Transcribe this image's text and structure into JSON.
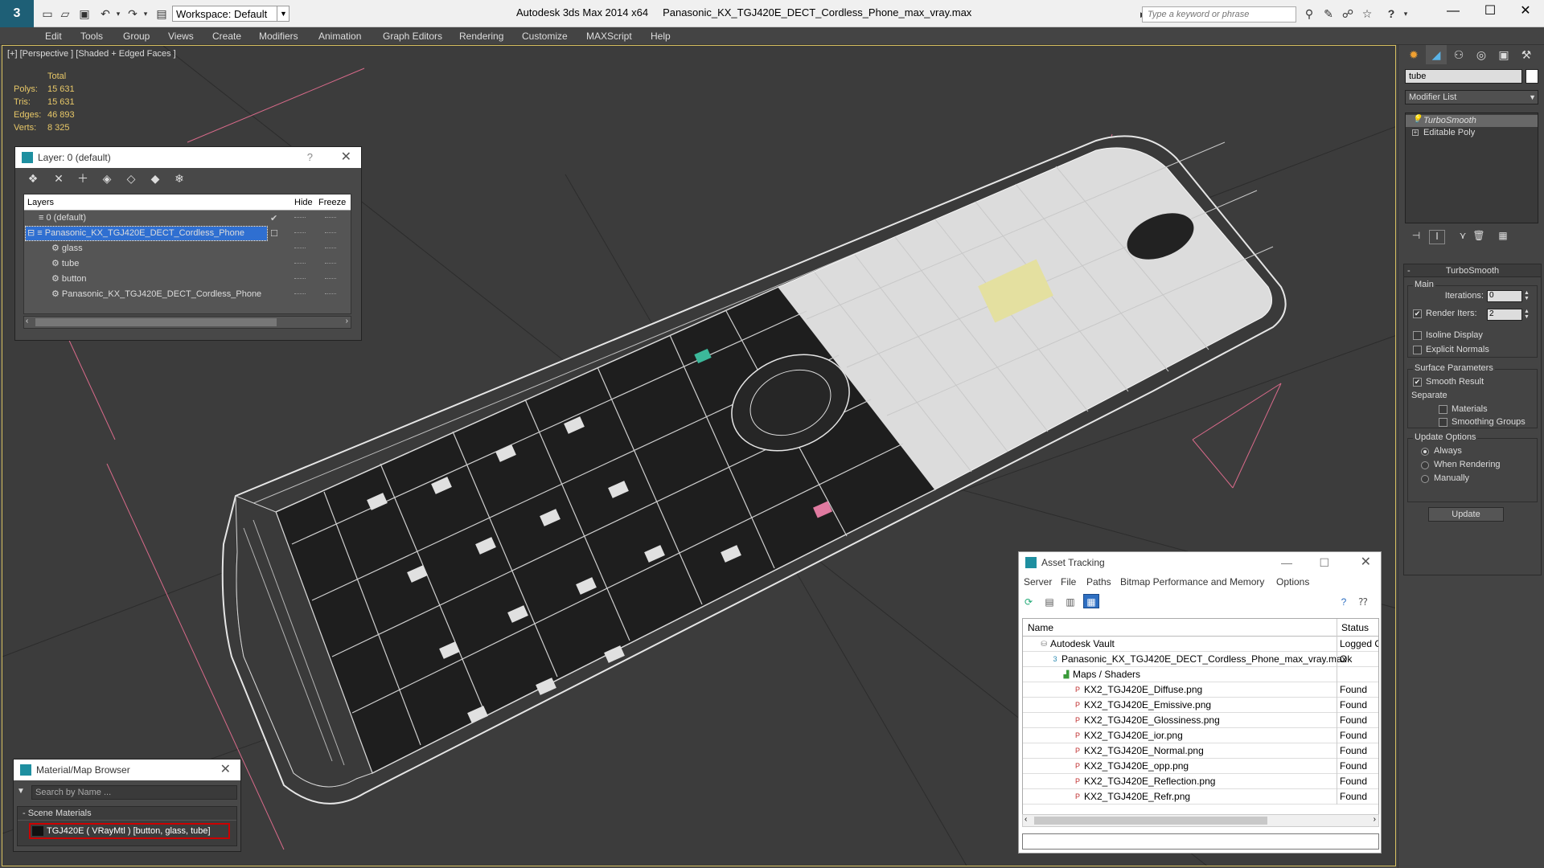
{
  "titlebar": {
    "workspace": "Workspace: Default",
    "app_name": "Autodesk 3ds Max  2014 x64",
    "file_name": "Panasonic_KX_TGJ420E_DECT_Cordless_Phone_max_vray.max",
    "search_placeholder": "Type a keyword or phrase",
    "help_icon": "?"
  },
  "menu": [
    "Edit",
    "Tools",
    "Group",
    "Views",
    "Create",
    "Modifiers",
    "Animation",
    "Graph Editors",
    "Rendering",
    "Customize",
    "MAXScript",
    "Help"
  ],
  "viewport": {
    "label": "[+] [Perspective ] [Shaded + Edged Faces ]",
    "stats": {
      "header": "Total",
      "rows": [
        {
          "label": "Polys:",
          "value": "15 631"
        },
        {
          "label": "Tris:",
          "value": "15 631"
        },
        {
          "label": "Edges:",
          "value": "46 893"
        },
        {
          "label": "Verts:",
          "value": "8 325"
        }
      ]
    }
  },
  "layer_dialog": {
    "title": "Layer: 0 (default)",
    "help": "?",
    "columns": {
      "layers": "Layers",
      "hide": "Hide",
      "freeze": "Freeze"
    },
    "rows": [
      {
        "name": "0 (default)",
        "indent": 0,
        "selected": false
      },
      {
        "name": "Panasonic_KX_TGJ420E_DECT_Cordless_Phone",
        "indent": 0,
        "selected": true
      },
      {
        "name": "glass",
        "indent": 1,
        "selected": false
      },
      {
        "name": "tube",
        "indent": 1,
        "selected": false
      },
      {
        "name": "button",
        "indent": 1,
        "selected": false
      },
      {
        "name": "Panasonic_KX_TGJ420E_DECT_Cordless_Phone",
        "indent": 1,
        "selected": false
      }
    ]
  },
  "material_browser": {
    "title": "Material/Map Browser",
    "search_placeholder": "Search by Name ...",
    "section": "- Scene Materials",
    "item": "TGJ420E  ( VRayMtl )  [button, glass, tube]"
  },
  "asset_tracking": {
    "title": "Asset Tracking",
    "menu": [
      "Server",
      "File",
      "Paths",
      "Bitmap Performance and Memory",
      "Options"
    ],
    "columns": {
      "name": "Name",
      "status": "Status"
    },
    "rows": [
      {
        "name": "Autodesk Vault",
        "status": "Logged O",
        "level": 0,
        "icon": "vault"
      },
      {
        "name": "Panasonic_KX_TGJ420E_DECT_Cordless_Phone_max_vray.max",
        "status": "Ok",
        "level": 1,
        "icon": "max"
      },
      {
        "name": "Maps / Shaders",
        "status": "",
        "level": 2,
        "icon": "maps"
      },
      {
        "name": "KX2_TGJ420E_Diffuse.png",
        "status": "Found",
        "level": 3,
        "icon": "png"
      },
      {
        "name": "KX2_TGJ420E_Emissive.png",
        "status": "Found",
        "level": 3,
        "icon": "png"
      },
      {
        "name": "KX2_TGJ420E_Glossiness.png",
        "status": "Found",
        "level": 3,
        "icon": "png"
      },
      {
        "name": "KX2_TGJ420E_ior.png",
        "status": "Found",
        "level": 3,
        "icon": "png"
      },
      {
        "name": "KX2_TGJ420E_Normal.png",
        "status": "Found",
        "level": 3,
        "icon": "png"
      },
      {
        "name": "KX2_TGJ420E_opp.png",
        "status": "Found",
        "level": 3,
        "icon": "png"
      },
      {
        "name": "KX2_TGJ420E_Reflection.png",
        "status": "Found",
        "level": 3,
        "icon": "png"
      },
      {
        "name": "KX2_TGJ420E_Refr.png",
        "status": "Found",
        "level": 3,
        "icon": "png"
      }
    ]
  },
  "command_panel": {
    "object_name": "tube",
    "modifier_list": "Modifier List",
    "stack": [
      "TurboSmooth",
      "Editable Poly"
    ],
    "rollout_title": "TurboSmooth",
    "main_group": "Main",
    "iterations_label": "Iterations:",
    "iterations_value": "0",
    "render_iters_label": "Render Iters:",
    "render_iters_value": "2",
    "render_iters_checked": true,
    "isoline_label": "Isoline Display",
    "explicit_normals_label": "Explicit Normals",
    "surface_group": "Surface Parameters",
    "smooth_result_label": "Smooth Result",
    "separate_label": "Separate",
    "materials_label": "Materials",
    "smoothing_groups_label": "Smoothing Groups",
    "update_group": "Update Options",
    "always_label": "Always",
    "when_rendering_label": "When Rendering",
    "manually_label": "Manually",
    "update_button": "Update"
  }
}
